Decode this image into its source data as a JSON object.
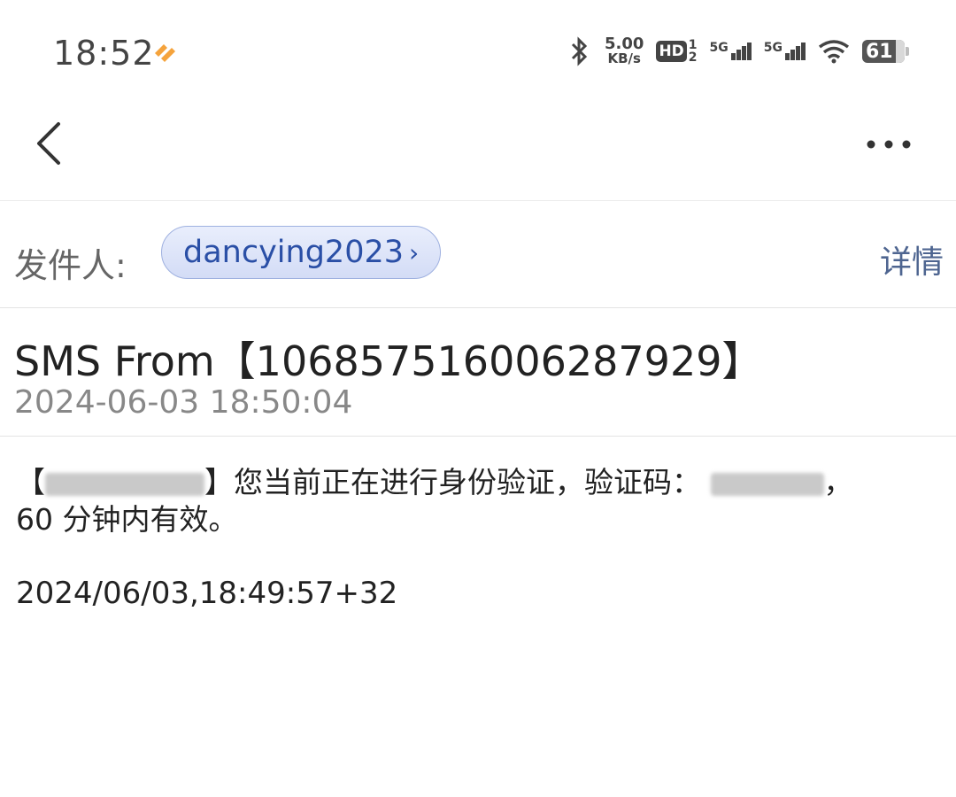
{
  "status_bar": {
    "time": "18:52",
    "net_speed_value": "5.00",
    "net_speed_unit": "KB/s",
    "hd_label": "HD",
    "sim_top": "1",
    "sim_bottom": "2",
    "signal1_label": "5G",
    "signal2_label": "5G",
    "battery_level": "61"
  },
  "toolbar": {
    "back_icon": "chevron-left-icon",
    "more_icon": "more-horizontal-icon"
  },
  "sender": {
    "label": "发件人:",
    "name": "dancying2023",
    "detail_link": "详情"
  },
  "message": {
    "subject": "SMS From【1068575160062879​29】",
    "date": "2024-06-03 18:50:04",
    "body_open_bracket": "【",
    "body_after_sender": "】您当前正在进行身份验证，验证码：",
    "body_after_code": "，",
    "body_line2": "60 分钟内有效。",
    "timestamp_line": "2024/06/03,18:49:57+32"
  },
  "colors": {
    "chip_text": "#2a4fa6",
    "detail_text": "#4e6590",
    "notification_accent": "#f5a33c"
  }
}
